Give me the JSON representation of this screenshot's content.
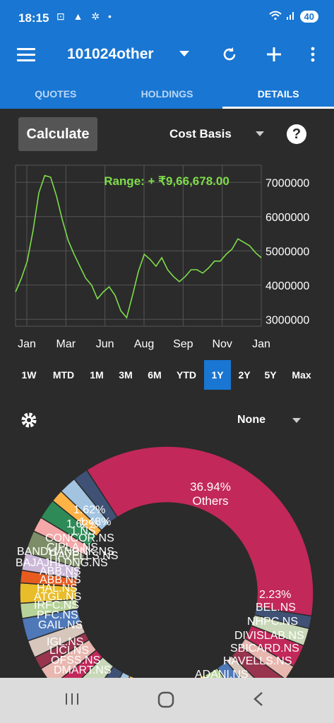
{
  "status_bar": {
    "time": "18:15",
    "left_icons": "⊡ ▲ ✲ •",
    "battery": "40"
  },
  "header": {
    "portfolio_name": "101024other"
  },
  "tabs": [
    {
      "label": "QUOTES"
    },
    {
      "label": "HOLDINGS"
    },
    {
      "label": "DETAILS"
    }
  ],
  "controls": {
    "calculate_label": "Calculate",
    "basis_selected": "Cost Basis",
    "group_selected": "None"
  },
  "chart_data": {
    "type": "line",
    "title": "Range: + ₹9,66,678.00",
    "line_color": "#7ddc4a",
    "x_ticks": [
      "Jan",
      "Mar",
      "Jun",
      "Aug",
      "Sep",
      "Nov",
      "Jan"
    ],
    "y_ticks": [
      "7000000",
      "6000000",
      "5000000",
      "4000000",
      "3000000"
    ],
    "ylim": [
      2800000,
      7500000
    ],
    "grid": true,
    "y_axis_side": "right",
    "values": [
      3800000,
      4200000,
      4700000,
      5600000,
      6700000,
      7200000,
      7150000,
      6600000,
      5900000,
      5300000,
      4900000,
      4550000,
      4200000,
      4000000,
      3600000,
      3800000,
      3950000,
      3700000,
      3250000,
      3050000,
      3700000,
      4400000,
      4900000,
      4750000,
      4550000,
      4800000,
      4450000,
      4250000,
      4100000,
      4250000,
      4450000,
      4450000,
      4350000,
      4500000,
      4700000,
      4700000,
      4900000,
      5050000,
      5350000,
      5250000,
      5150000,
      4950000,
      4800000
    ]
  },
  "ranges": [
    "1W",
    "MTD",
    "1M",
    "3M",
    "6M",
    "YTD",
    "1Y",
    "2Y",
    "5Y",
    "Max"
  ],
  "active_range": "1Y",
  "donut": {
    "big_slice_label": "36.94%",
    "big_slice_name": "Others",
    "big_slice_color": "#c2285a",
    "labels": [
      {
        "text": "1.62%"
      },
      {
        "text": "1.62%"
      },
      {
        "text": "1.48%"
      },
      {
        "text": "1.NS"
      },
      {
        "text": "CONCOR.NS"
      },
      {
        "text": "CIPLA.NS"
      },
      {
        "text": "HAVELLS.NS"
      },
      {
        "text": "BANDHANBNK.NS"
      },
      {
        "text": "BAJAJHLDNG.NS"
      },
      {
        "text": "ABB.NS"
      },
      {
        "text": "ABB.NS"
      },
      {
        "text": "HAL.NS"
      },
      {
        "text": "ATGL.NS"
      },
      {
        "text": "IRFC.NS"
      },
      {
        "text": "PFC.NS"
      },
      {
        "text": "GAIL.NS"
      },
      {
        "text": "IGL.NS"
      },
      {
        "text": "LICI.NS"
      },
      {
        "text": "OFSS.NS"
      },
      {
        "text": "DMART.NS"
      },
      {
        "text": "2.23%"
      },
      {
        "text": "BEL.NS"
      },
      {
        "text": "NHPC.NS"
      },
      {
        "text": "DIVISLAB.NS"
      },
      {
        "text": "SBICARD.NS"
      },
      {
        "text": "HAVELLS.NS"
      },
      {
        "text": "ADANI.NS"
      }
    ]
  }
}
